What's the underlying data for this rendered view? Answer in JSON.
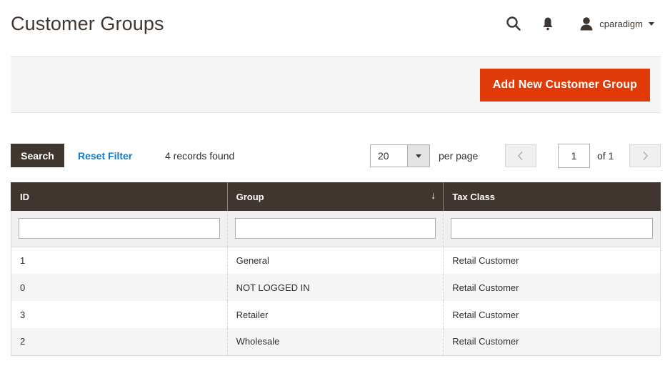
{
  "header": {
    "title": "Customer Groups",
    "user_name": "cparadigm",
    "icons": {
      "search": "search-icon",
      "notifications": "bell-icon",
      "user": "user-icon",
      "menu": "caret-down-icon"
    }
  },
  "actions": {
    "add_button_label": "Add New Customer Group",
    "accent_color": "#e13a09"
  },
  "toolbar": {
    "search_label": "Search",
    "reset_label": "Reset Filter",
    "records_found": "4 records found",
    "per_page_value": "20",
    "per_page_label": "per page",
    "current_page": "1",
    "page_of": "of 1",
    "prev_icon": "<",
    "next_icon": ">"
  },
  "grid": {
    "columns": [
      {
        "label": "ID"
      },
      {
        "label": "Group",
        "sorted": "desc",
        "sort_icon": "↓"
      },
      {
        "label": "Tax Class"
      }
    ],
    "filters": [
      "",
      "",
      ""
    ],
    "rows": [
      {
        "id": "1",
        "group": "General",
        "tax_class": "Retail Customer"
      },
      {
        "id": "0",
        "group": "NOT LOGGED IN",
        "tax_class": "Retail Customer"
      },
      {
        "id": "3",
        "group": "Retailer",
        "tax_class": "Retail Customer"
      },
      {
        "id": "2",
        "group": "Wholesale",
        "tax_class": "Retail Customer"
      }
    ]
  }
}
